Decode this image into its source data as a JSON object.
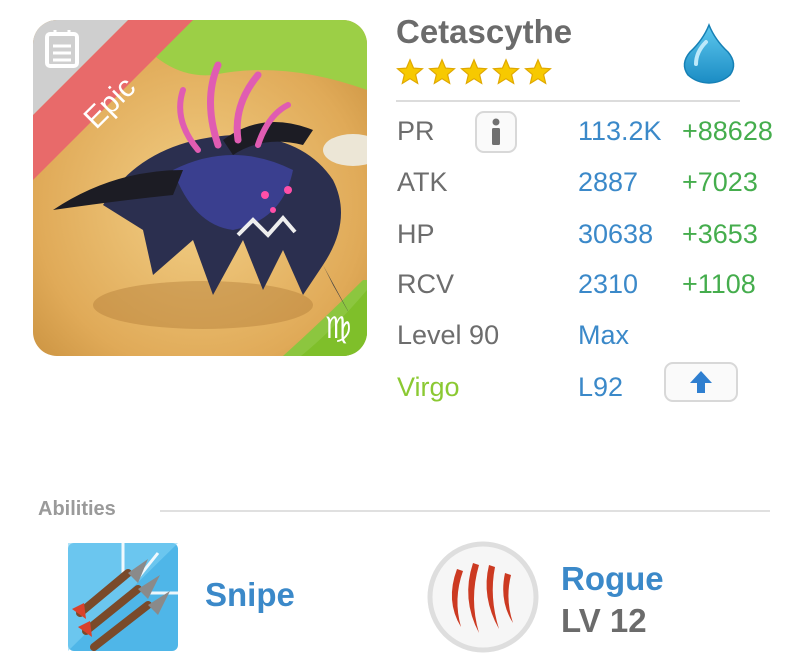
{
  "monster": {
    "name": "Cetascythe",
    "rarity": "Epic",
    "stars": 5,
    "element_icon": "water-drop-icon",
    "sign_glyph": "♍",
    "sign_name": "Virgo"
  },
  "stats": [
    {
      "label": "PR",
      "value": "113.2K",
      "bonus": "+88628"
    },
    {
      "label": "ATK",
      "value": "2887",
      "bonus": "+7023"
    },
    {
      "label": "HP",
      "value": "30638",
      "bonus": "+3653"
    },
    {
      "label": "RCV",
      "value": "2310",
      "bonus": "+1108"
    }
  ],
  "level": {
    "label": "Level 90",
    "value": "Max"
  },
  "sign_row": {
    "label": "Virgo",
    "value": "L92"
  },
  "abilities": {
    "header": "Abilities",
    "items": [
      {
        "name": "Snipe",
        "icon": "arrows-icon"
      },
      {
        "name": "Rogue",
        "level": "LV 12",
        "icon": "claw-marks-icon"
      }
    ]
  },
  "colors": {
    "accent_blue": "#3b89c9",
    "bonus_green": "#45ad4d",
    "sign_green": "#8bc932",
    "epic_red": "#e86a6a"
  }
}
